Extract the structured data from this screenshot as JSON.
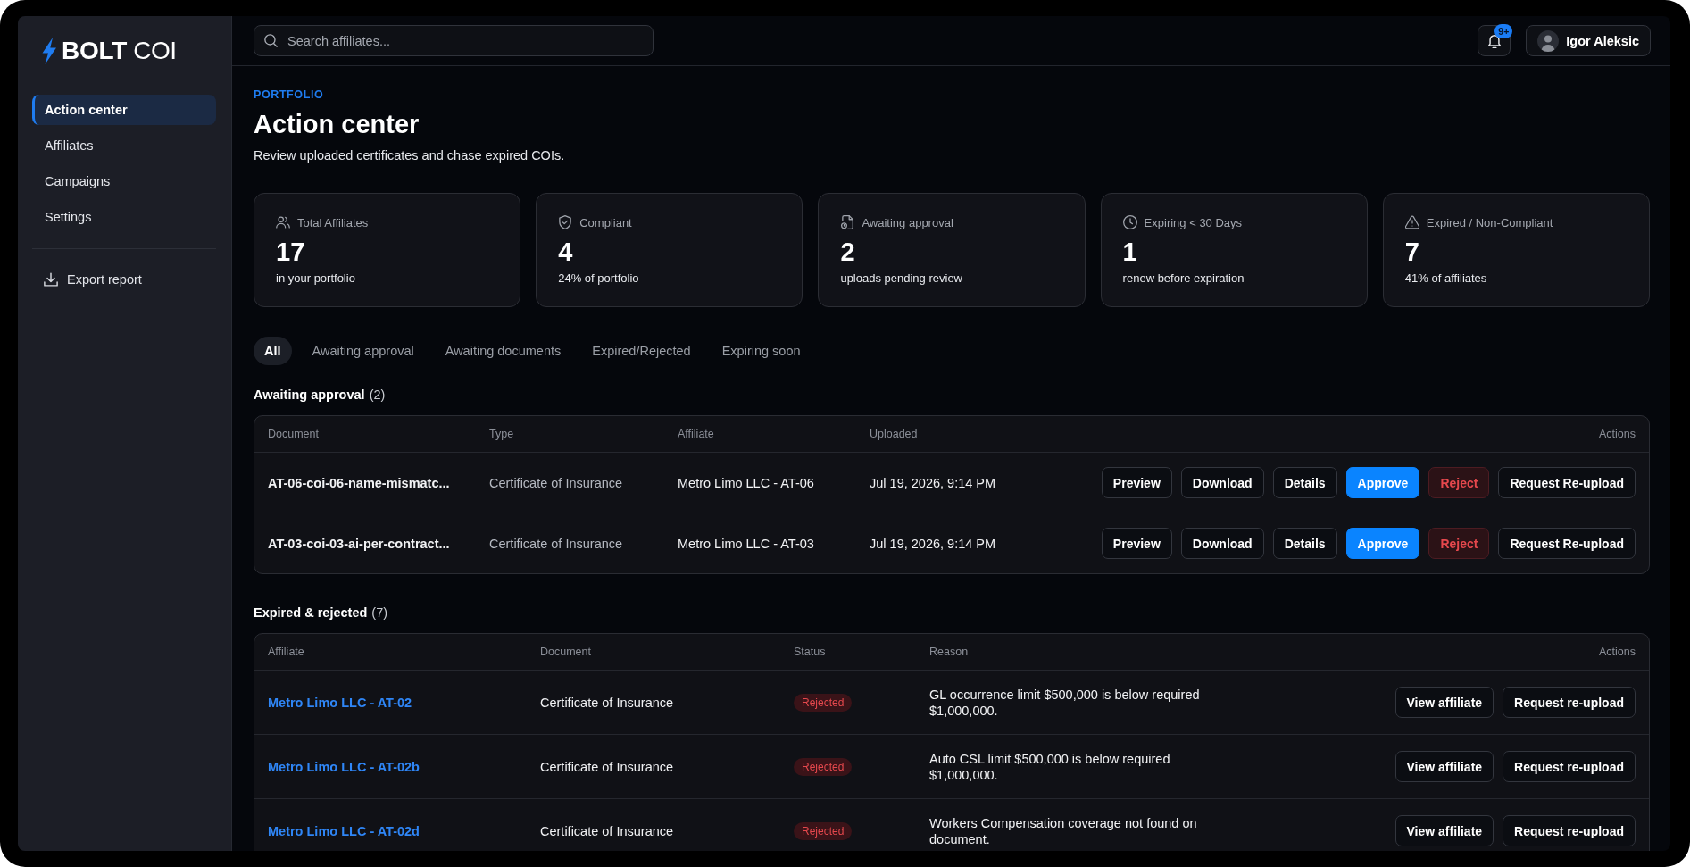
{
  "sidebar": {
    "logo": "**BOLT** COI",
    "items": [
      {
        "label": "Action center",
        "selected": true
      },
      {
        "label": "Affiliates",
        "selected": false
      },
      {
        "label": "Campaigns",
        "selected": false
      },
      {
        "label": "Settings",
        "selected": false
      }
    ],
    "export": {
      "label": "Export report"
    }
  },
  "topbar": {
    "search": {
      "placeholder": "Search affiliates..."
    },
    "notifications": {
      "badge": "9+"
    },
    "user": {
      "name": "Igor Aleksic"
    }
  },
  "header": {
    "eyebrow": "PORTFOLIO",
    "title": "Action center",
    "subtitle": "Review uploaded certificates and chase expired COIs."
  },
  "stats": [
    {
      "kind": "users",
      "label": "Total Affiliates",
      "value": "17",
      "note": "in your portfolio"
    },
    {
      "kind": "shield",
      "label": "Compliant",
      "value": "4",
      "note": "24% of portfolio"
    },
    {
      "kind": "file",
      "label": "Awaiting approval",
      "value": "2",
      "note": "uploads pending review"
    },
    {
      "kind": "clock",
      "label": "Expiring < 30 Days",
      "value": "1",
      "note": "renew before expiration"
    },
    {
      "kind": "warning",
      "label": "Expired / Non-Compliant",
      "value": "7",
      "note": "41% of affiliates"
    }
  ],
  "filter_tabs": [
    {
      "label": "All",
      "selected": true
    },
    {
      "label": "Awaiting approval",
      "selected": false
    },
    {
      "label": "Awaiting documents",
      "selected": false
    },
    {
      "label": "Expired/Rejected",
      "selected": false
    },
    {
      "label": "Expiring soon",
      "selected": false
    }
  ],
  "awaiting_approval": {
    "title": "Awaiting approval",
    "count": "(2)",
    "columns": [
      "Document",
      "Type",
      "Affiliate",
      "Uploaded",
      "Actions"
    ],
    "rows": [
      {
        "document": "AT-06-coi-06-name-mismatc...",
        "type": "Certificate of Insurance",
        "affiliate": "Metro Limo LLC - AT-06",
        "uploaded": "Jul 19, 2026, 9:14 PM",
        "actions": [
          {
            "label": "Preview",
            "kind": "outline"
          },
          {
            "label": "Download",
            "kind": "outline"
          },
          {
            "label": "Details",
            "kind": "outline"
          },
          {
            "label": "Approve",
            "kind": "primary"
          },
          {
            "label": "Reject",
            "kind": "danger"
          },
          {
            "label": "Request Re-upload",
            "kind": "outline"
          }
        ]
      },
      {
        "document": "AT-03-coi-03-ai-per-contract...",
        "type": "Certificate of Insurance",
        "affiliate": "Metro Limo LLC - AT-03",
        "uploaded": "Jul 19, 2026, 9:14 PM",
        "actions": [
          {
            "label": "Preview",
            "kind": "outline"
          },
          {
            "label": "Download",
            "kind": "outline"
          },
          {
            "label": "Details",
            "kind": "outline"
          },
          {
            "label": "Approve",
            "kind": "primary"
          },
          {
            "label": "Reject",
            "kind": "danger"
          },
          {
            "label": "Request Re-upload",
            "kind": "outline"
          }
        ]
      }
    ]
  },
  "expired_rejected": {
    "title": "Expired & rejected",
    "count": "(7)",
    "columns": [
      "Affiliate",
      "Document",
      "Status",
      "Reason",
      "Actions"
    ],
    "rows": [
      {
        "affiliate": "Metro Limo LLC - AT-02",
        "document": "Certificate of Insurance",
        "status": "Rejected",
        "reason": "GL occurrence limit $500,000 is below required $1,000,000.",
        "actions": [
          {
            "label": "View affiliate",
            "kind": "outline"
          },
          {
            "label": "Request re-upload",
            "kind": "outline"
          }
        ]
      },
      {
        "affiliate": "Metro Limo LLC - AT-02b",
        "document": "Certificate of Insurance",
        "status": "Rejected",
        "reason": "Auto CSL limit $500,000 is below required $1,000,000.",
        "actions": [
          {
            "label": "View affiliate",
            "kind": "outline"
          },
          {
            "label": "Request re-upload",
            "kind": "outline"
          }
        ]
      },
      {
        "affiliate": "Metro Limo LLC - AT-02d",
        "document": "Certificate of Insurance",
        "status": "Rejected",
        "reason": "Workers Compensation coverage not found on document.",
        "actions": [
          {
            "label": "View affiliate",
            "kind": "outline"
          },
          {
            "label": "Request re-upload",
            "kind": "outline"
          }
        ]
      }
    ]
  }
}
